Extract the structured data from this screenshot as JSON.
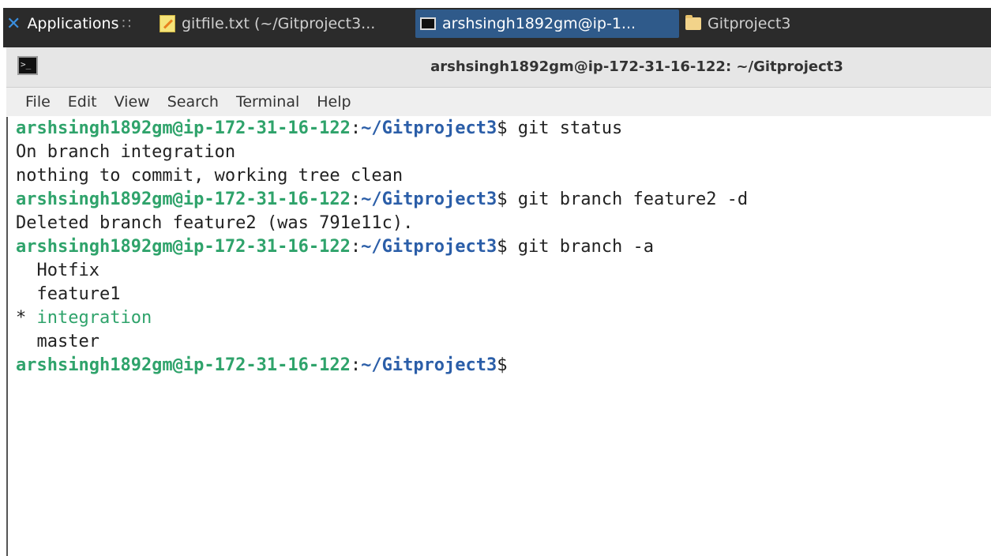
{
  "taskbar": {
    "apps_label": "Applications",
    "apps_sep": "∷",
    "tasks": [
      {
        "label": "gitfile.txt (~/Gitproject3..."
      },
      {
        "label": "arshsingh1892gm@ip-1..."
      },
      {
        "label": "Gitproject3"
      }
    ]
  },
  "window": {
    "title": "arshsingh1892gm@ip-172-31-16-122: ~/Gitproject3",
    "icon_glyph": ">_"
  },
  "menu": [
    "File",
    "Edit",
    "View",
    "Search",
    "Terminal",
    "Help"
  ],
  "terminal": {
    "prompt_user": "arshsingh1892gm@ip-172-31-16-122",
    "prompt_sep": ":",
    "prompt_path": "~/Gitproject3",
    "prompt_end": "$",
    "cmd1": " git status",
    "out1": "On branch integration",
    "out2": "nothing to commit, working tree clean",
    "cmd2": " git branch feature2 -d",
    "out3": "Deleted branch feature2 (was 791e11c).",
    "cmd3": " git branch -a",
    "branches": [
      "  Hotfix",
      "  feature1",
      "  master"
    ],
    "current_marker": "* ",
    "current_branch": "integration"
  },
  "colors": {
    "prompt_user": "#2fa36b",
    "prompt_path": "#2b5ea8",
    "active_task": "#2f5a8a"
  }
}
